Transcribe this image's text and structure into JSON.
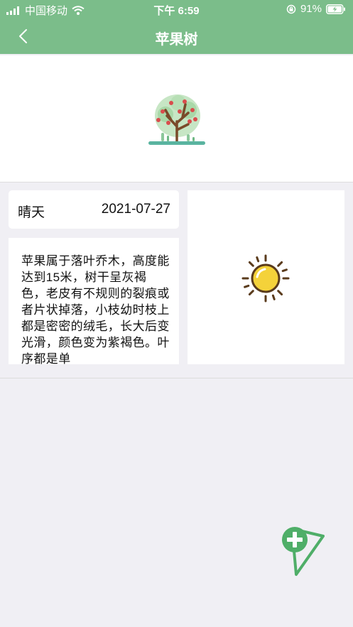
{
  "status_bar": {
    "carrier": "中国移动",
    "time": "下午 6:59",
    "battery": "91%"
  },
  "nav": {
    "title": "苹果树"
  },
  "card": {
    "weather": "晴天",
    "date": "2021-07-27",
    "description": "苹果属于落叶乔木，高度能达到15米，树干呈灰褐色，老皮有不规则的裂痕或者片状掉落，小枝幼时枝上都是密密的绒毛，长大后变光滑，颜色变为紫褐色。叶序都是单"
  },
  "colors": {
    "header": "#7bbd8a",
    "background": "#f0eff4",
    "fab": "#4fae68",
    "sun": "#f4d23a"
  },
  "icons": {
    "back": "chevron-left-icon",
    "tree": "apple-tree-icon",
    "sun": "sun-icon",
    "fab": "add-location-icon"
  }
}
